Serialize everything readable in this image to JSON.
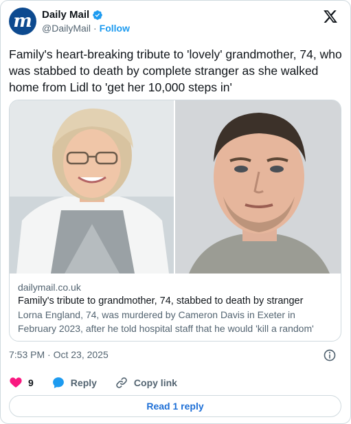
{
  "author": {
    "name": "Daily Mail",
    "handle": "@DailyMail",
    "separator": "·",
    "follow_label": "Follow",
    "avatar_text": "m"
  },
  "tweet": {
    "text": "Family's heart-breaking tribute to 'lovely' grandmother, 74, who was stabbed to death by complete stranger as she walked home from Lidl to 'get her 10,000 steps in'"
  },
  "link_card": {
    "domain": "dailymail.co.uk",
    "title": "Family's tribute to grandmother, 74, stabbed to death by stranger",
    "description": "Lorna England, 74, was murdered by Cameron Davis in Exeter in February 2023, after he told hospital staff that he would 'kill a random' person if h..."
  },
  "timestamp": "7:53 PM · Oct 23, 2025",
  "actions": {
    "like_count": "9",
    "reply_label": "Reply",
    "copy_label": "Copy link"
  },
  "read_replies_label": "Read 1 reply",
  "colors": {
    "accent": "#1d9bf0",
    "like": "#f91880",
    "brand_avatar": "#0d4a8f",
    "text_secondary": "#536471"
  }
}
